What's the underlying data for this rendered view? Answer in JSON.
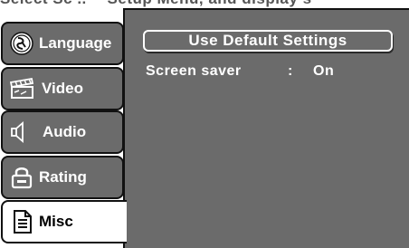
{
  "header": {
    "clipped_text": "Select   Sc  ..   ·· Setup Menu, and display s"
  },
  "sidebar": {
    "items": [
      {
        "label": "Language",
        "icon": "language-disc-icon",
        "active": false
      },
      {
        "label": "Video",
        "icon": "clapperboard-icon",
        "active": false
      },
      {
        "label": "Audio",
        "icon": "speaker-icon",
        "active": false
      },
      {
        "label": "Rating",
        "icon": "lock-icon",
        "active": false
      },
      {
        "label": "Misc",
        "icon": "document-icon",
        "active": true
      }
    ]
  },
  "panel": {
    "default_button_label": "Use Default Settings",
    "settings": [
      {
        "name": "Screen saver",
        "separator": ":",
        "value": "On"
      }
    ]
  },
  "colors": {
    "panel_bg": "#6b6b6b",
    "text": "#ffffff",
    "border": "#111111",
    "active_tab_bg": "#ffffff"
  }
}
